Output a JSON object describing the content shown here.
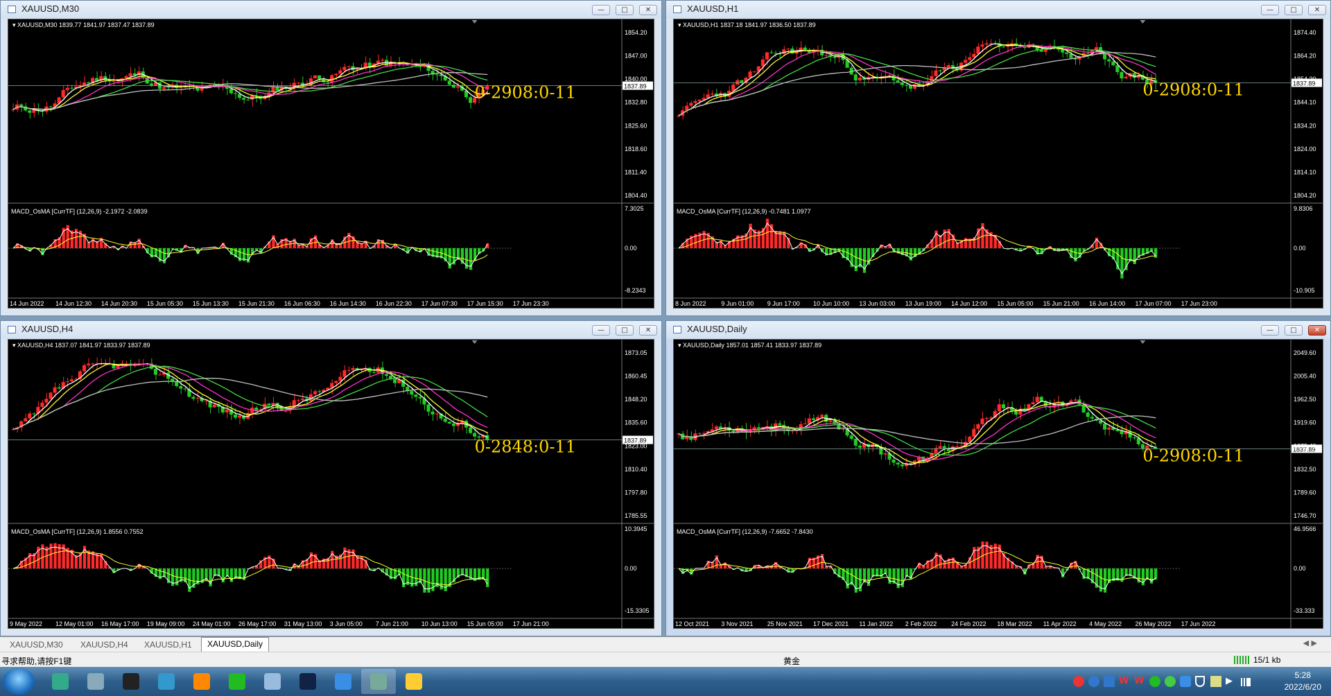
{
  "colors": {
    "bull": "#ff2a2a",
    "bear": "#22cc22",
    "ma_white": "#ffffff",
    "ma_yellow": "#ffff33",
    "ma_magenta": "#ff33cc",
    "ma_green": "#44dd44",
    "ma_gray": "#c0c0c0",
    "overlay": "#ffd700",
    "axis": "#ffffff"
  },
  "windows": [
    {
      "id": "m30",
      "title": "XAUUSD,M30",
      "info": "XAUUSD,M30  1839.77 1841.97 1837.47 1837.89",
      "macd_info": "MACD_OsMA [CurrTF] (12,26,9) -2.1972 -2.0839",
      "overlay": "0-2908:0-11",
      "price_labels": [
        "1854.20",
        "1847.00",
        "1840.00",
        "1832.80",
        "1825.60",
        "1818.60",
        "1811.40",
        "1804.40"
      ],
      "current_price": "1837.89",
      "macd_labels": [
        "7.3025",
        "0.00",
        "-8.2343"
      ],
      "time_labels": [
        "14 Jun 2022",
        "14 Jun 12:30",
        "14 Jun 20:30",
        "15 Jun 05:30",
        "15 Jun 13:30",
        "15 Jun 21:30",
        "16 Jun 06:30",
        "16 Jun 14:30",
        "16 Jun 22:30",
        "17 Jun 07:30",
        "17 Jun 15:30",
        "17 Jun 23:30"
      ],
      "seed": 11
    },
    {
      "id": "h1",
      "title": "XAUUSD,H1",
      "info": "XAUUSD,H1  1837.18 1841.97 1836.50 1837.89",
      "macd_info": "MACD_OsMA [CurrTF] (12,26,9) -0.7481 1.0977",
      "overlay": "0-2908:0-11",
      "price_labels": [
        "1874.40",
        "1864.20",
        "1854.30",
        "1844.10",
        "1834.20",
        "1824.00",
        "1814.10",
        "1804.20"
      ],
      "current_price": "1837.89",
      "macd_labels": [
        "9.8306",
        "0.00",
        "-10.905"
      ],
      "time_labels": [
        "8 Jun 2022",
        "9 Jun 01:00",
        "9 Jun 17:00",
        "10 Jun 10:00",
        "13 Jun 03:00",
        "13 Jun 19:00",
        "14 Jun 12:00",
        "15 Jun 05:00",
        "15 Jun 21:00",
        "16 Jun 14:00",
        "17 Jun 07:00",
        "17 Jun 23:00"
      ],
      "seed": 23
    },
    {
      "id": "h4",
      "title": "XAUUSD,H4",
      "info": "XAUUSD,H4  1837.07 1841.97 1833.97 1837.89",
      "macd_info": "MACD_OsMA [CurrTF] (12,26,9) 1.8556 0.7552",
      "overlay": "0-2848:0-11",
      "price_labels": [
        "1873.05",
        "1860.45",
        "1848.20",
        "1835.60",
        "1823.00",
        "1810.40",
        "1797.80",
        "1785.55"
      ],
      "current_price": "1837.89",
      "macd_labels": [
        "10.3945",
        "0.00",
        "-15.3305"
      ],
      "time_labels": [
        "9 May 2022",
        "12 May 01:00",
        "16 May 17:00",
        "19 May 09:00",
        "24 May 01:00",
        "26 May 17:00",
        "31 May 13:00",
        "3 Jun 05:00",
        "7 Jun 21:00",
        "10 Jun 13:00",
        "15 Jun 05:00",
        "17 Jun 21:00"
      ],
      "seed": 37
    },
    {
      "id": "d1",
      "title": "XAUUSD,Daily",
      "info": "XAUUSD,Daily  1857.01 1857.41 1833.97 1837.89",
      "macd_info": "MACD_OsMA [CurrTF] (12,26,9) -7.6652 -7.8430",
      "overlay": "0-2908:0-11",
      "price_labels": [
        "2049.60",
        "2005.40",
        "1962.50",
        "1919.60",
        "1875.40",
        "1832.50",
        "1789.60",
        "1746.70"
      ],
      "current_price": "1837.89",
      "macd_labels": [
        "46.9566",
        "0.00",
        "-33.333"
      ],
      "time_labels": [
        "12 Oct 2021",
        "3 Nov 2021",
        "25 Nov 2021",
        "17 Dec 2021",
        "11 Jan 2022",
        "2 Feb 2022",
        "24 Feb 2022",
        "18 Mar 2022",
        "11 Apr 2022",
        "4 May 2022",
        "26 May 2022",
        "17 Jun 2022"
      ],
      "seed": 53
    }
  ],
  "tabs": [
    "XAUUSD,M30",
    "XAUUSD,H4",
    "XAUUSD,H1",
    "XAUUSD,Daily"
  ],
  "status": {
    "help": "寻求帮助,请按F1键",
    "profile": "黄金",
    "traffic": "15/1 kb"
  },
  "clock": {
    "time": "5:28",
    "date": "2022/6/20"
  },
  "taskbar_icons": [
    "start-orb-icon",
    "app-icon",
    "explorer-icon",
    "mt4-icon",
    "monitor-icon",
    "firefox-icon",
    "wechat-icon",
    "notes-icon",
    "photoshop-icon",
    "feishu-icon",
    "network-app-icon",
    "folder-icon"
  ]
}
